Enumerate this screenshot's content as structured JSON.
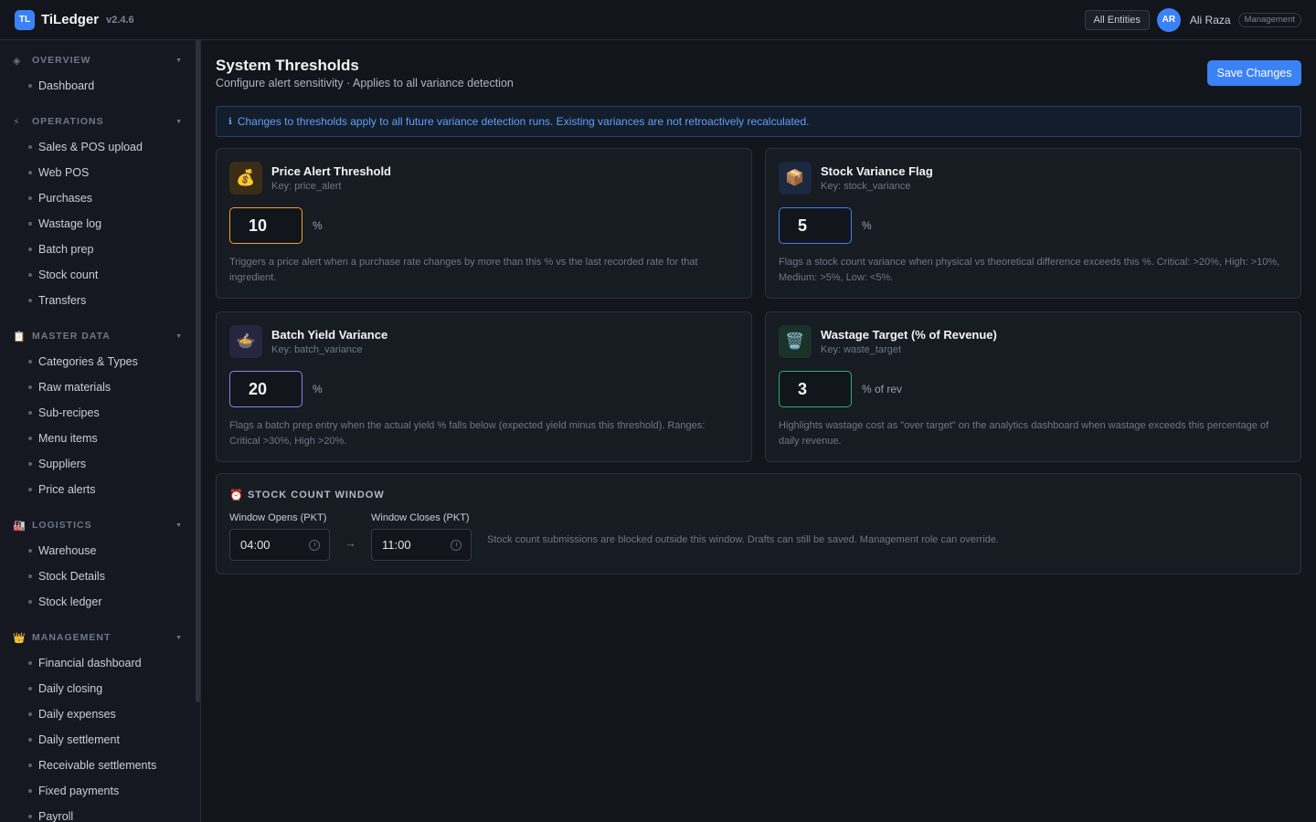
{
  "app": {
    "logo": "TL",
    "name": "TiLedger",
    "version": "v2.4.6"
  },
  "header": {
    "entity_button": "All Entities",
    "avatar_initials": "AR",
    "user_name": "Ali Raza",
    "role": "Management"
  },
  "sidebar": {
    "sections": [
      {
        "icon": "◈",
        "icon_name": "overview-icon",
        "title": "OVERVIEW",
        "items": [
          "Dashboard"
        ]
      },
      {
        "icon": "⚡",
        "icon_name": "lightning-icon",
        "title": "OPERATIONS",
        "items": [
          "Sales & POS upload",
          "Web POS",
          "Purchases",
          "Wastage log",
          "Batch prep",
          "Stock count",
          "Transfers"
        ]
      },
      {
        "icon": "📋",
        "icon_name": "clipboard-icon",
        "title": "MASTER DATA",
        "items": [
          "Categories & Types",
          "Raw materials",
          "Sub-recipes",
          "Menu items",
          "Suppliers",
          "Price alerts"
        ]
      },
      {
        "icon": "🏭",
        "icon_name": "factory-icon",
        "title": "LOGISTICS",
        "items": [
          "Warehouse",
          "Stock Details",
          "Stock ledger"
        ]
      },
      {
        "icon": "👑",
        "icon_name": "crown-icon",
        "title": "MANAGEMENT",
        "items": [
          "Financial dashboard",
          "Daily closing",
          "Daily expenses",
          "Daily settlement",
          "Receivable settlements",
          "Fixed payments",
          "Payroll"
        ]
      }
    ]
  },
  "main": {
    "title": "System Thresholds",
    "subtitle": "Configure alert sensitivity · Applies to all variance detection",
    "save_label": "Save Changes",
    "info_icon": "ℹ",
    "info_text": "Changes to thresholds apply to all future variance detection runs. Existing variances are not retroactively recalculated.",
    "cards": [
      {
        "icon": "💰",
        "icon_name": "money-bag-icon",
        "icon_bg": "#3a2c17",
        "title": "Price Alert Threshold",
        "key": "Key: price_alert",
        "value": "10",
        "unit": "%",
        "accent": "#f0a030",
        "description": "Triggers a price alert when a purchase rate changes by more than this % vs the last recorded rate for that ingredient."
      },
      {
        "icon": "📦",
        "icon_name": "package-icon",
        "icon_bg": "#1c2740",
        "title": "Stock Variance Flag",
        "key": "Key: stock_variance",
        "value": "5",
        "unit": "%",
        "accent": "#3b82f6",
        "description": "Flags a stock count variance when physical vs theoretical difference exceeds this %. Critical: >20%, High: >10%, Medium: >5%, Low: <5%."
      },
      {
        "icon": "🍲",
        "icon_name": "bowl-icon",
        "icon_bg": "#272540",
        "title": "Batch Yield Variance",
        "key": "Key: batch_variance",
        "value": "20",
        "unit": "%",
        "accent": "#8b7ff0",
        "description": "Flags a batch prep entry when the actual yield % falls below (expected yield minus this threshold). Ranges: Critical >30%, High >20%."
      },
      {
        "icon": "🗑️",
        "icon_name": "trash-icon",
        "icon_bg": "#1a3329",
        "title": "Wastage Target (% of Revenue)",
        "key": "Key: waste_target",
        "value": "3",
        "unit": "% of rev",
        "accent": "#22b573",
        "description": "Highlights wastage cost as \"over target\" on the analytics dashboard when wastage exceeds this percentage of daily revenue."
      }
    ],
    "window": {
      "icon": "⏰",
      "title": "STOCK COUNT WINDOW",
      "opens_label": "Window Opens (PKT)",
      "opens_value": "04:00",
      "closes_label": "Window Closes (PKT)",
      "closes_value": "11:00",
      "arrow": "→",
      "note": "Stock count submissions are blocked outside this window. Drafts can still be saved. Management role can override."
    }
  }
}
